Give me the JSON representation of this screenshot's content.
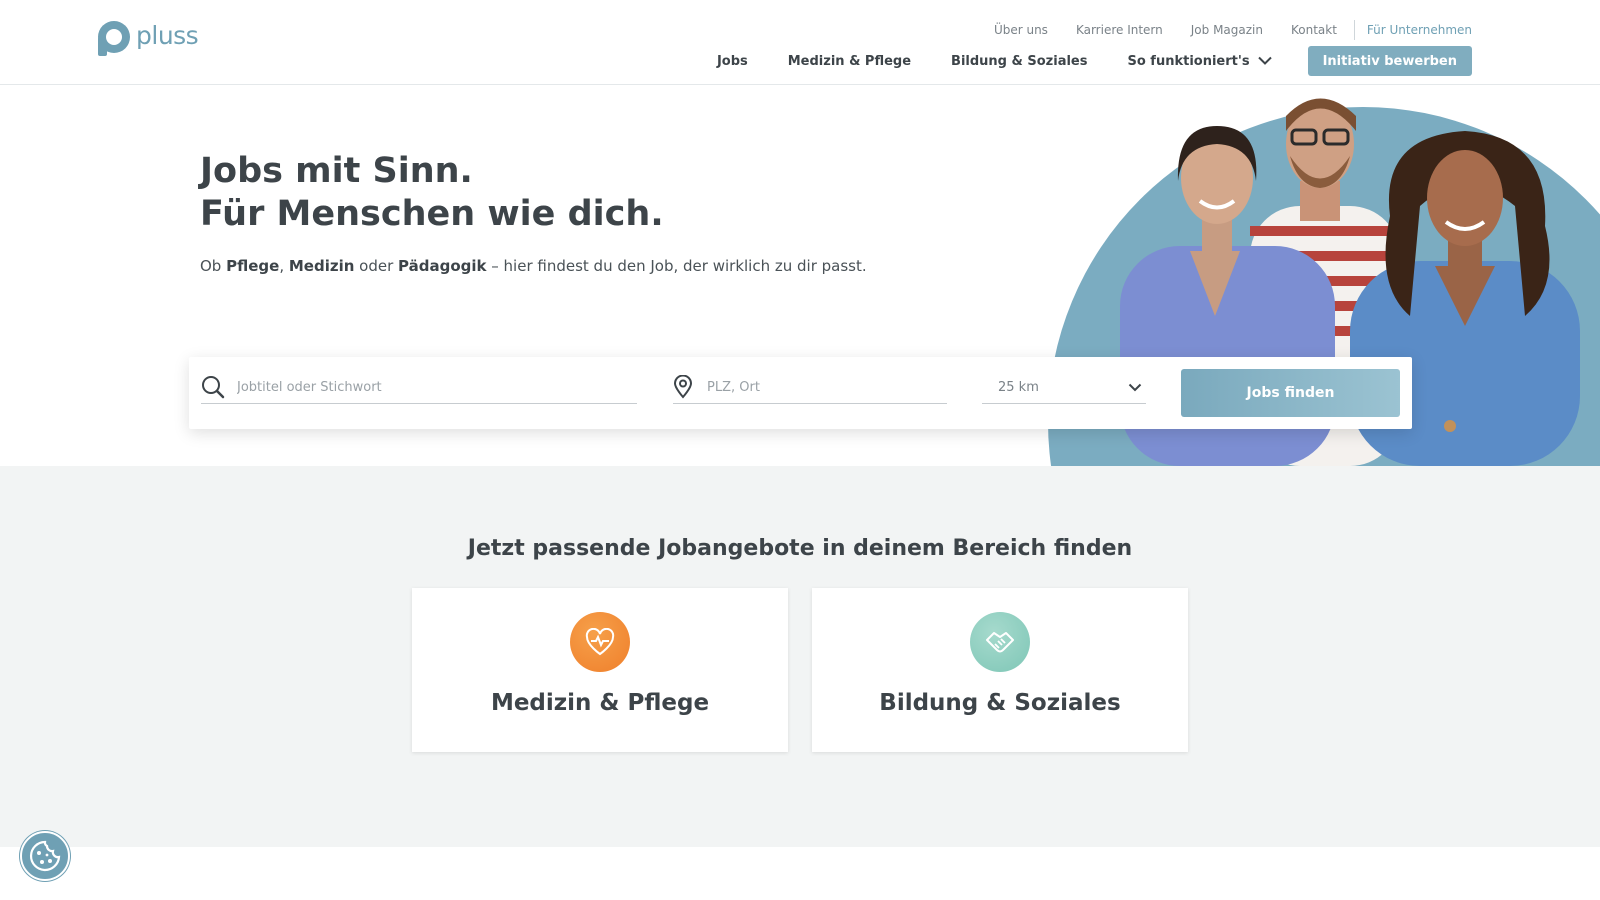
{
  "brand": {
    "name": "pluss",
    "color": "#6fa0b4"
  },
  "topnav": {
    "items": [
      "Über uns",
      "Karriere Intern",
      "Job Magazin",
      "Kontakt"
    ],
    "business": "Für Unternehmen"
  },
  "mainnav": {
    "items": [
      "Jobs",
      "Medizin & Pflege",
      "Bildung & Soziales",
      "So funktioniert's"
    ],
    "cta": "Initiativ bewerben"
  },
  "hero": {
    "line1": "Jobs mit Sinn.",
    "line2": "Für Menschen wie dich.",
    "sub_prefix": "Ob ",
    "sub_b1": "Pflege",
    "sub_sep1": ", ",
    "sub_b2": "Medizin",
    "sub_sep2": " oder ",
    "sub_b3": "Pädagogik",
    "sub_suffix": " – hier findest du den Job, der wirklich zu dir passt."
  },
  "search": {
    "job_placeholder": "Jobtitel oder Stichwort",
    "location_placeholder": "PLZ, Ort",
    "radius": "25 km",
    "button": "Jobs finden"
  },
  "categories": {
    "title": "Jetzt passende Jobangebote in deinem Bereich finden",
    "items": [
      {
        "label": "Medizin & Pflege",
        "icon": "heart-pulse-icon",
        "color": "#ef7f2b"
      },
      {
        "label": "Bildung & Soziales",
        "icon": "handshake-icon",
        "color": "#8ccbbd"
      }
    ]
  },
  "colors": {
    "accent": "#80adbf",
    "text": "#3d4449",
    "section_bg": "#f2f4f4"
  }
}
